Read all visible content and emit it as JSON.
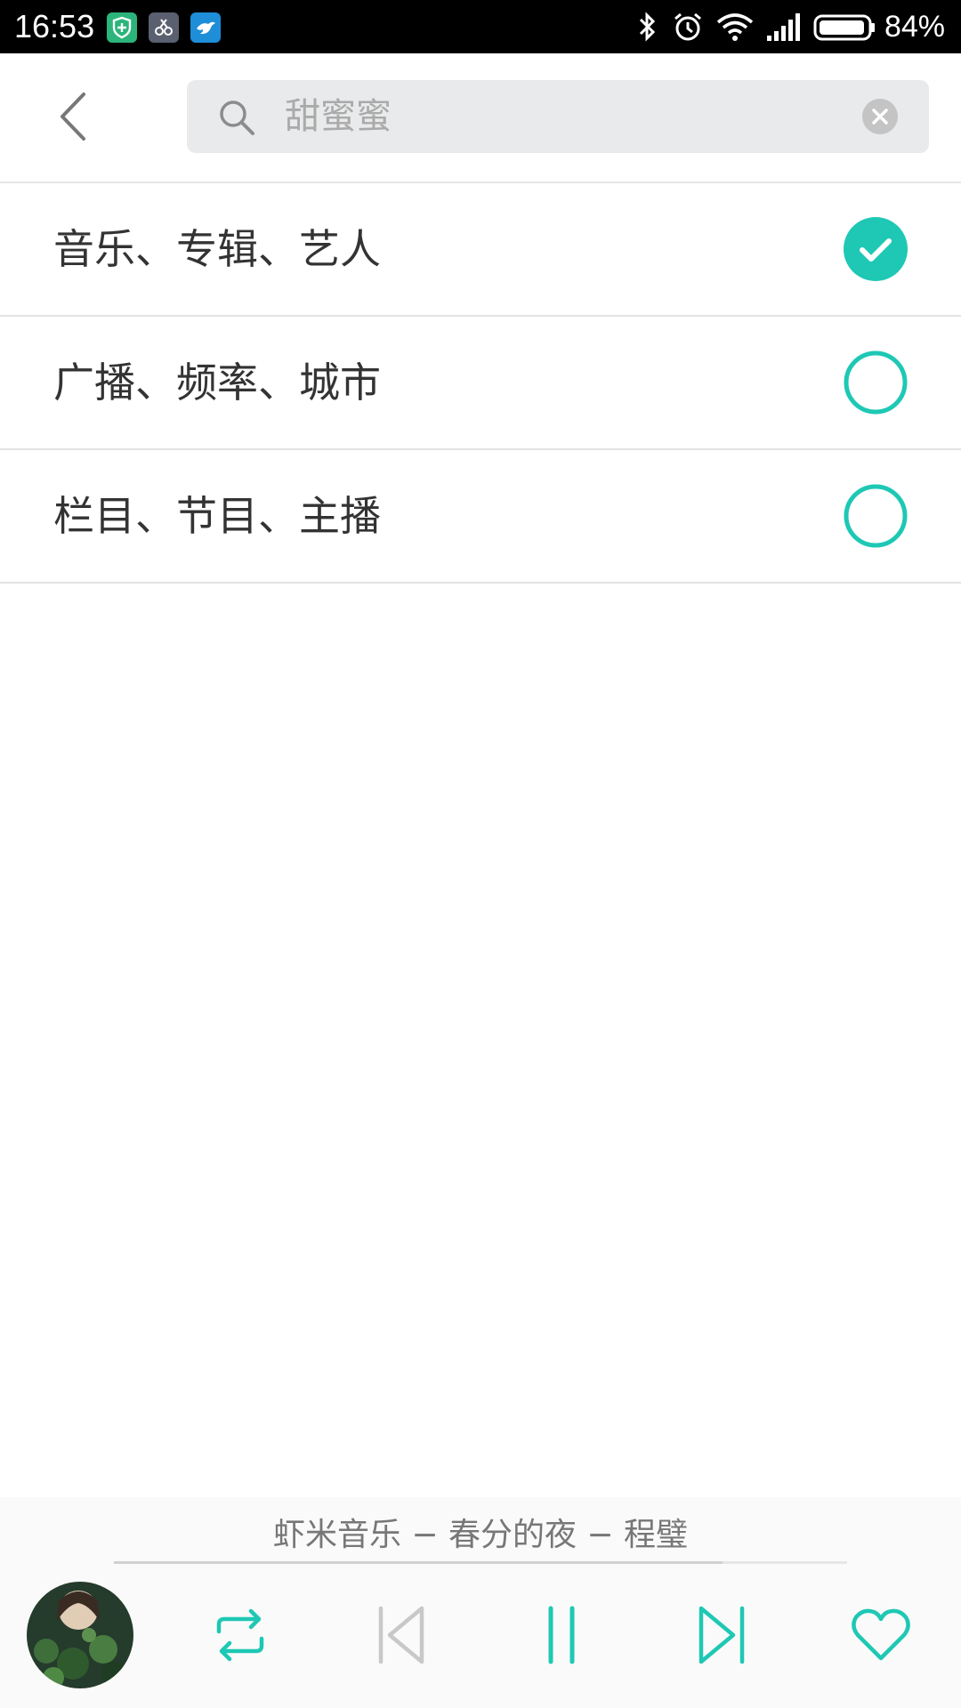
{
  "status_bar": {
    "time": "16:53",
    "battery_percent": "84%",
    "notification_icons": [
      "shield-app-icon",
      "scissors-app-icon",
      "bird-app-icon"
    ],
    "system_icons": [
      "bluetooth-icon",
      "alarm-icon",
      "wifi-icon",
      "signal-icon",
      "battery-icon"
    ]
  },
  "header": {
    "search": {
      "placeholder": "甜蜜蜜",
      "value": ""
    }
  },
  "options": [
    {
      "label": "音乐、专辑、艺人",
      "selected": true
    },
    {
      "label": "广播、频率、城市",
      "selected": false
    },
    {
      "label": "栏目、节目、主播",
      "selected": false
    }
  ],
  "player": {
    "now_playing": "虾米音乐 − 春分的夜 − 程璧",
    "progress": 0.83,
    "controls": [
      "repeat-icon",
      "previous-icon",
      "pause-icon",
      "next-icon",
      "heart-icon"
    ]
  },
  "colors": {
    "accent": "#1ec8b4",
    "text_primary": "#333333",
    "text_secondary": "#777777",
    "search_bg": "#e9eaeb"
  }
}
